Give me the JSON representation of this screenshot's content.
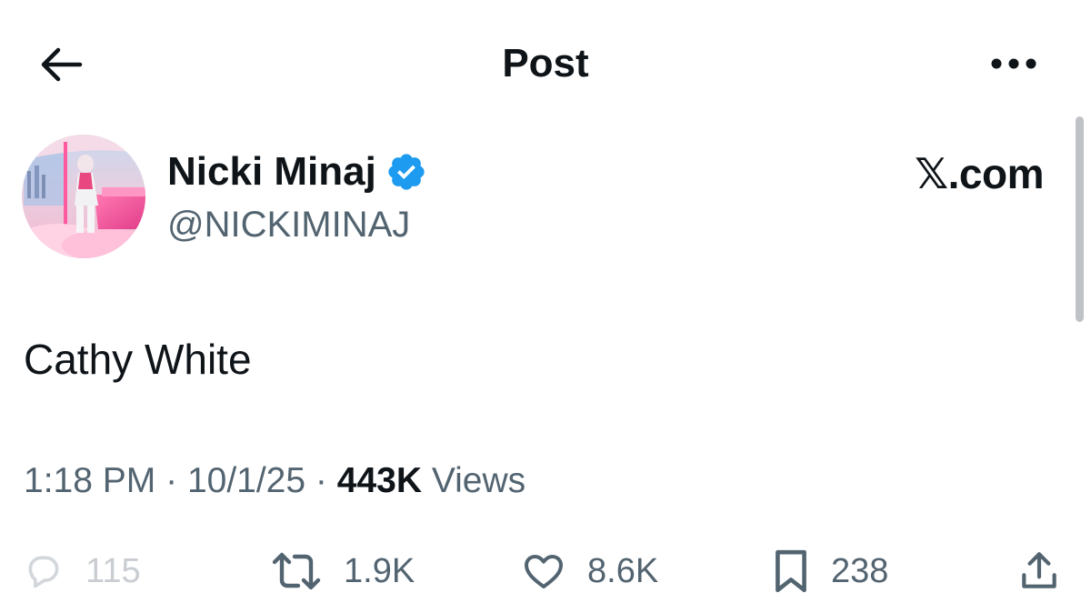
{
  "header": {
    "title": "Post",
    "back_icon": "arrow-left-icon",
    "more_icon": "more-horizontal-icon"
  },
  "author": {
    "name": "Nicki Minaj",
    "handle": "@NICKIMINAJ",
    "verified": true,
    "verified_color": "#1d9bf0"
  },
  "brand": {
    "label": "𝕏.com"
  },
  "post": {
    "text": "Cathy White"
  },
  "meta": {
    "time": "1:18 PM",
    "separator": "·",
    "date": "10/1/25",
    "views_count": "443K",
    "views_label": "Views"
  },
  "actions": {
    "replies": "115",
    "reposts": "1.9K",
    "likes": "8.6K",
    "bookmarks": "238"
  },
  "colors": {
    "text_primary": "#0f1419",
    "text_secondary": "#536471",
    "accent": "#1d9bf0"
  }
}
